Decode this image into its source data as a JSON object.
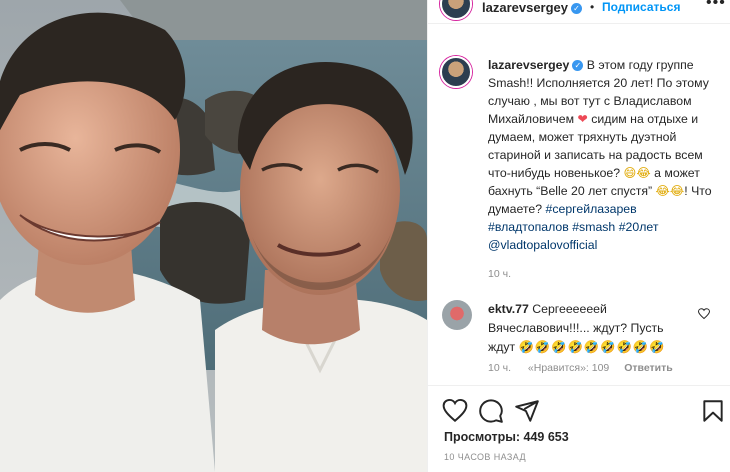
{
  "post": {
    "username": "lazarevsergey",
    "verified_icon": "verified-badge-icon",
    "separator": "•",
    "follow_label": "Подписаться",
    "more_icon": "more-options-icon"
  },
  "caption": {
    "username": "lazarevsergey",
    "text_1": "В этом году группе Smash!! Исполняется 20 лет! По этому случаю , мы вот тут с Владиславом Михайловичем",
    "heart": "❤",
    "text_2": "сидим на отдыхе и думаем, может тряхнуть дуэтной стариной и записать на радость всем что-нибудь новенькое?",
    "emoji_1": "😄😂",
    "text_3": "а может бахнуть “Belle 20 лет спустя”",
    "emoji_2": "😂😂",
    "text_4": "! Что думаете?",
    "tag_1": "#сергейлазарев",
    "tag_2": "#владтопалов",
    "tag_3": "#smash",
    "tag_4": "#20лет",
    "mention": "@vladtopalovofficial",
    "time": "10 ч."
  },
  "comment": {
    "username": "ektv.77",
    "text": "Сергеееееей Вячеславович!!!... ждут? Пусть ждут",
    "emoji": "🤣🤣🤣🤣🤣🤣🤣🤣🤣",
    "time": "10 ч.",
    "likes": "«Нравится»: 109",
    "reply": "Ответить",
    "heart_icon": "heart-outline-icon"
  },
  "actions": {
    "icons": [
      "like-icon",
      "comment-icon",
      "share-icon",
      "save-icon"
    ],
    "views": "Просмотры: 449 653",
    "ago": "10 ЧАСОВ НАЗАД"
  }
}
